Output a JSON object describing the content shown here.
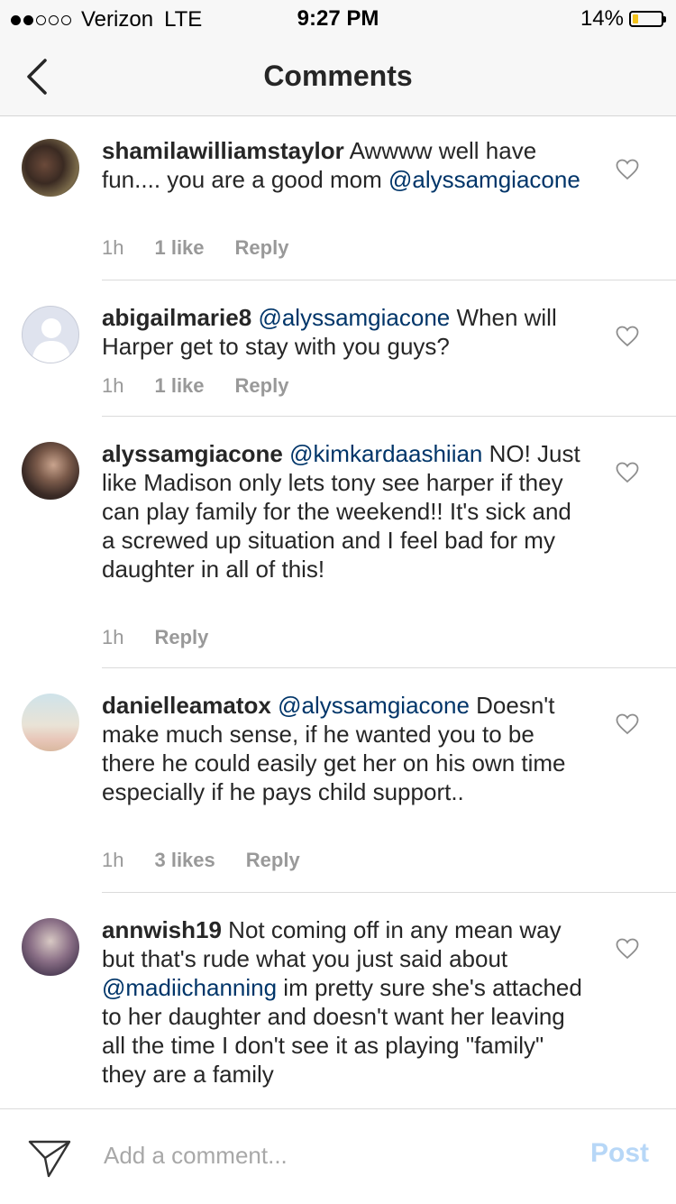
{
  "status_bar": {
    "carrier": "Verizon",
    "network": "LTE",
    "time": "9:27 PM",
    "battery": "14%"
  },
  "nav": {
    "title": "Comments",
    "back_icon": "chevron-left-icon"
  },
  "comments": [
    {
      "username": "shamilawilliamstaylor",
      "text_before": " Awwww well have fun.... you are a good mom ",
      "mention": "@alyssamgiacone",
      "text_after": "",
      "time": "1h",
      "likes": "1 like",
      "reply": "Reply"
    },
    {
      "username": "abigailmarie8",
      "text_before": " ",
      "mention": "@alyssamgiacone",
      "text_after": " When will Harper get to stay with you guys?",
      "time": "1h",
      "likes": "1 like",
      "reply": "Reply"
    },
    {
      "username": "alyssamgiacone",
      "text_before": " ",
      "mention": "@kimkardaashiian",
      "text_after": " NO! Just like Madison only lets tony see harper if they can play family for the weekend!! It's sick and a screwed up situation and I feel bad for my daughter in all of this!",
      "time": "1h",
      "likes": "",
      "reply": "Reply"
    },
    {
      "username": "danielleamatox",
      "text_before": " ",
      "mention": "@alyssamgiacone",
      "text_after": " Doesn't make much sense, if he wanted you to be there he could easily get her on his own time especially if he pays child support..",
      "time": "1h",
      "likes": "3 likes",
      "reply": "Reply"
    },
    {
      "username": "annwish19",
      "text_before": " Not coming off in any mean way but that's rude what you just said about ",
      "mention": "@madiichanning",
      "text_after": " im pretty sure she's attached to her daughter and doesn't want her leaving all the time I don't see it as playing \"family\" they are a family",
      "time": "",
      "likes": "",
      "reply": ""
    }
  ],
  "composer": {
    "placeholder": "Add a comment...",
    "post_label": "Post",
    "send_icon": "paper-plane-icon"
  },
  "colors": {
    "mention": "#003569",
    "post_disabled": "#b7d7f7",
    "battery_low": "#f2c21b"
  }
}
